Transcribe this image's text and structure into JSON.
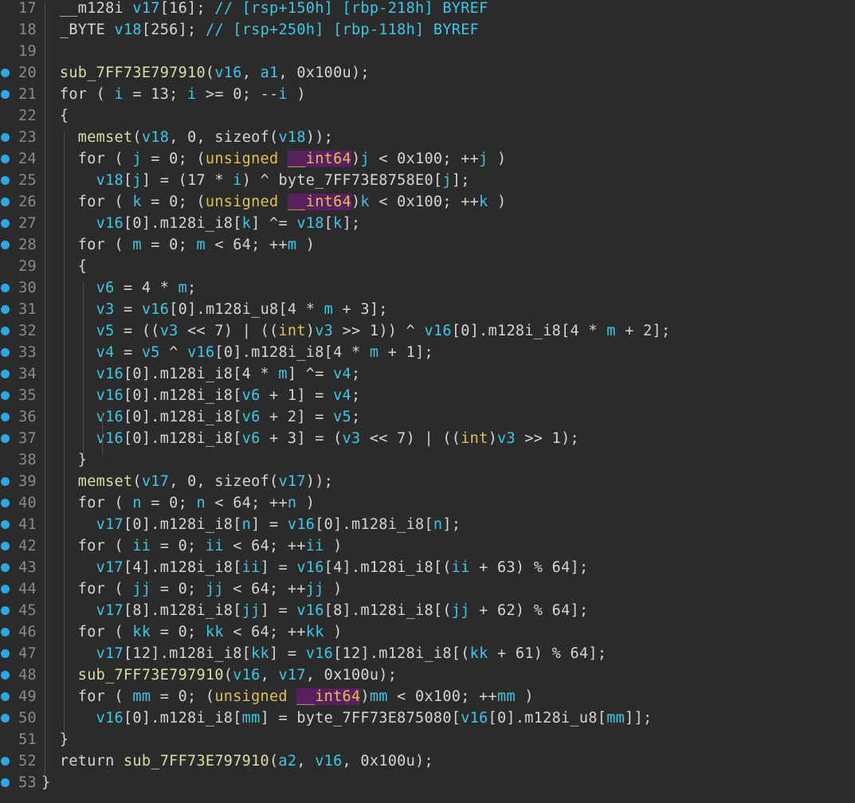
{
  "colors": {
    "background": "#2b2b2b",
    "line_number": "#8a8a8a",
    "breakpoint": "#29a8e8",
    "variable": "#3ac8e8",
    "type": "#e0c14f",
    "highlight": "#5a1f5e",
    "text": "#d4d4d4"
  },
  "lines": [
    {
      "num": "17",
      "bp": false,
      "tokens": [
        [
          "plain",
          "  "
        ],
        [
          "plain",
          "__m128i "
        ],
        [
          "var",
          "v17"
        ],
        [
          "plain",
          "[16]; "
        ],
        [
          "cmt",
          "// [rsp+150h] [rbp-218h] BYREF"
        ]
      ]
    },
    {
      "num": "18",
      "bp": false,
      "tokens": [
        [
          "plain",
          "  "
        ],
        [
          "plain",
          "_BYTE "
        ],
        [
          "var",
          "v18"
        ],
        [
          "plain",
          "[256]; "
        ],
        [
          "cmt",
          "// [rsp+250h] [rbp-118h] BYREF"
        ]
      ]
    },
    {
      "num": "19",
      "bp": false,
      "tokens": []
    },
    {
      "num": "20",
      "bp": true,
      "tokens": [
        [
          "plain",
          "  "
        ],
        [
          "func",
          "sub_7FF73E797910"
        ],
        [
          "plain",
          "("
        ],
        [
          "var",
          "v16"
        ],
        [
          "plain",
          ", "
        ],
        [
          "var",
          "a1"
        ],
        [
          "plain",
          ", 0x100u);"
        ]
      ]
    },
    {
      "num": "21",
      "bp": true,
      "tokens": [
        [
          "plain",
          "  for ( "
        ],
        [
          "var",
          "i"
        ],
        [
          "plain",
          " = 13; "
        ],
        [
          "var",
          "i"
        ],
        [
          "plain",
          " >= 0; --"
        ],
        [
          "var",
          "i"
        ],
        [
          "plain",
          " )"
        ]
      ]
    },
    {
      "num": "22",
      "bp": false,
      "tokens": [
        [
          "plain",
          "  {"
        ]
      ]
    },
    {
      "num": "23",
      "bp": true,
      "tokens": [
        [
          "plain",
          "    "
        ],
        [
          "func",
          "memset"
        ],
        [
          "plain",
          "("
        ],
        [
          "var",
          "v18"
        ],
        [
          "plain",
          ", 0, sizeof("
        ],
        [
          "var",
          "v18"
        ],
        [
          "plain",
          "));"
        ]
      ]
    },
    {
      "num": "24",
      "bp": true,
      "tokens": [
        [
          "plain",
          "    for ( "
        ],
        [
          "var",
          "j"
        ],
        [
          "plain",
          " = 0; ("
        ],
        [
          "type",
          "unsigned "
        ],
        [
          "typehl",
          "__int64"
        ],
        [
          "plain",
          ")"
        ],
        [
          "var",
          "j"
        ],
        [
          "plain",
          " < 0x100; ++"
        ],
        [
          "var",
          "j"
        ],
        [
          "plain",
          " )"
        ]
      ]
    },
    {
      "num": "25",
      "bp": true,
      "tokens": [
        [
          "plain",
          "      "
        ],
        [
          "var",
          "v18"
        ],
        [
          "plain",
          "["
        ],
        [
          "var",
          "j"
        ],
        [
          "plain",
          "] = (17 * "
        ],
        [
          "var",
          "i"
        ],
        [
          "plain",
          ") ^ byte_7FF73E8758E0["
        ],
        [
          "var",
          "j"
        ],
        [
          "plain",
          "];"
        ]
      ]
    },
    {
      "num": "26",
      "bp": true,
      "tokens": [
        [
          "plain",
          "    for ( "
        ],
        [
          "var",
          "k"
        ],
        [
          "plain",
          " = 0; ("
        ],
        [
          "type",
          "unsigned "
        ],
        [
          "typehl",
          "__int64"
        ],
        [
          "plain",
          ")"
        ],
        [
          "var",
          "k"
        ],
        [
          "plain",
          " < 0x100; ++"
        ],
        [
          "var",
          "k"
        ],
        [
          "plain",
          " )"
        ]
      ]
    },
    {
      "num": "27",
      "bp": true,
      "tokens": [
        [
          "plain",
          "      "
        ],
        [
          "var",
          "v16"
        ],
        [
          "plain",
          "[0].m128i_i8["
        ],
        [
          "var",
          "k"
        ],
        [
          "plain",
          "] ^= "
        ],
        [
          "var",
          "v18"
        ],
        [
          "plain",
          "["
        ],
        [
          "var",
          "k"
        ],
        [
          "plain",
          "];"
        ]
      ]
    },
    {
      "num": "28",
      "bp": true,
      "tokens": [
        [
          "plain",
          "    for ( "
        ],
        [
          "var",
          "m"
        ],
        [
          "plain",
          " = 0; "
        ],
        [
          "var",
          "m"
        ],
        [
          "plain",
          " < 64; ++"
        ],
        [
          "var",
          "m"
        ],
        [
          "plain",
          " )"
        ]
      ]
    },
    {
      "num": "29",
      "bp": false,
      "tokens": [
        [
          "plain",
          "    {"
        ]
      ]
    },
    {
      "num": "30",
      "bp": true,
      "tokens": [
        [
          "plain",
          "      "
        ],
        [
          "var",
          "v6"
        ],
        [
          "plain",
          " = 4 * "
        ],
        [
          "var",
          "m"
        ],
        [
          "plain",
          ";"
        ]
      ]
    },
    {
      "num": "31",
      "bp": true,
      "tokens": [
        [
          "plain",
          "      "
        ],
        [
          "var",
          "v3"
        ],
        [
          "plain",
          " = "
        ],
        [
          "var",
          "v16"
        ],
        [
          "plain",
          "[0].m128i_u8[4 * "
        ],
        [
          "var",
          "m"
        ],
        [
          "plain",
          " + 3];"
        ]
      ]
    },
    {
      "num": "32",
      "bp": true,
      "tokens": [
        [
          "plain",
          "      "
        ],
        [
          "var",
          "v5"
        ],
        [
          "plain",
          " = (("
        ],
        [
          "var",
          "v3"
        ],
        [
          "plain",
          " << 7) | (("
        ],
        [
          "type",
          "int"
        ],
        [
          "plain",
          ")"
        ],
        [
          "var",
          "v3"
        ],
        [
          "plain",
          " >> 1)) ^ "
        ],
        [
          "var",
          "v16"
        ],
        [
          "plain",
          "[0].m128i_i8[4 * "
        ],
        [
          "var",
          "m"
        ],
        [
          "plain",
          " + 2];"
        ]
      ]
    },
    {
      "num": "33",
      "bp": true,
      "tokens": [
        [
          "plain",
          "      "
        ],
        [
          "var",
          "v4"
        ],
        [
          "plain",
          " = "
        ],
        [
          "var",
          "v5"
        ],
        [
          "plain",
          " ^ "
        ],
        [
          "var",
          "v16"
        ],
        [
          "plain",
          "[0].m128i_i8[4 * "
        ],
        [
          "var",
          "m"
        ],
        [
          "plain",
          " + 1];"
        ]
      ]
    },
    {
      "num": "34",
      "bp": true,
      "tokens": [
        [
          "plain",
          "      "
        ],
        [
          "var",
          "v16"
        ],
        [
          "plain",
          "[0].m128i_i8[4 * "
        ],
        [
          "var",
          "m"
        ],
        [
          "plain",
          "] ^= "
        ],
        [
          "var",
          "v4"
        ],
        [
          "plain",
          ";"
        ]
      ]
    },
    {
      "num": "35",
      "bp": true,
      "tokens": [
        [
          "plain",
          "      "
        ],
        [
          "var",
          "v16"
        ],
        [
          "plain",
          "[0].m128i_i8["
        ],
        [
          "var",
          "v6"
        ],
        [
          "plain",
          " + 1] = "
        ],
        [
          "var",
          "v4"
        ],
        [
          "plain",
          ";"
        ]
      ]
    },
    {
      "num": "36",
      "bp": true,
      "tokens": [
        [
          "plain",
          "      "
        ],
        [
          "var",
          "v16"
        ],
        [
          "plain",
          "[0].m128i_i8["
        ],
        [
          "var",
          "v6"
        ],
        [
          "plain",
          " + 2] = "
        ],
        [
          "var",
          "v5"
        ],
        [
          "plain",
          ";"
        ]
      ]
    },
    {
      "num": "37",
      "bp": true,
      "tokens": [
        [
          "plain",
          "      "
        ],
        [
          "var",
          "v16"
        ],
        [
          "plain",
          "[0].m128i_i8["
        ],
        [
          "var",
          "v6"
        ],
        [
          "plain",
          " + 3] = ("
        ],
        [
          "var",
          "v3"
        ],
        [
          "plain",
          " << 7) | (("
        ],
        [
          "type",
          "int"
        ],
        [
          "plain",
          ")"
        ],
        [
          "var",
          "v3"
        ],
        [
          "plain",
          " >> 1);"
        ]
      ]
    },
    {
      "num": "38",
      "bp": false,
      "tokens": [
        [
          "plain",
          "    }"
        ]
      ]
    },
    {
      "num": "39",
      "bp": true,
      "tokens": [
        [
          "plain",
          "    "
        ],
        [
          "func",
          "memset"
        ],
        [
          "plain",
          "("
        ],
        [
          "var",
          "v17"
        ],
        [
          "plain",
          ", 0, sizeof("
        ],
        [
          "var",
          "v17"
        ],
        [
          "plain",
          "));"
        ]
      ]
    },
    {
      "num": "40",
      "bp": true,
      "tokens": [
        [
          "plain",
          "    for ( "
        ],
        [
          "var",
          "n"
        ],
        [
          "plain",
          " = 0; "
        ],
        [
          "var",
          "n"
        ],
        [
          "plain",
          " < 64; ++"
        ],
        [
          "var",
          "n"
        ],
        [
          "plain",
          " )"
        ]
      ]
    },
    {
      "num": "41",
      "bp": true,
      "tokens": [
        [
          "plain",
          "      "
        ],
        [
          "var",
          "v17"
        ],
        [
          "plain",
          "[0].m128i_i8["
        ],
        [
          "var",
          "n"
        ],
        [
          "plain",
          "] = "
        ],
        [
          "var",
          "v16"
        ],
        [
          "plain",
          "[0].m128i_i8["
        ],
        [
          "var",
          "n"
        ],
        [
          "plain",
          "];"
        ]
      ]
    },
    {
      "num": "42",
      "bp": true,
      "tokens": [
        [
          "plain",
          "    for ( "
        ],
        [
          "var",
          "ii"
        ],
        [
          "plain",
          " = 0; "
        ],
        [
          "var",
          "ii"
        ],
        [
          "plain",
          " < 64; ++"
        ],
        [
          "var",
          "ii"
        ],
        [
          "plain",
          " )"
        ]
      ]
    },
    {
      "num": "43",
      "bp": true,
      "tokens": [
        [
          "plain",
          "      "
        ],
        [
          "var",
          "v17"
        ],
        [
          "plain",
          "[4].m128i_i8["
        ],
        [
          "var",
          "ii"
        ],
        [
          "plain",
          "] = "
        ],
        [
          "var",
          "v16"
        ],
        [
          "plain",
          "[4].m128i_i8[("
        ],
        [
          "var",
          "ii"
        ],
        [
          "plain",
          " + 63) % 64];"
        ]
      ]
    },
    {
      "num": "44",
      "bp": true,
      "tokens": [
        [
          "plain",
          "    for ( "
        ],
        [
          "var",
          "jj"
        ],
        [
          "plain",
          " = 0; "
        ],
        [
          "var",
          "jj"
        ],
        [
          "plain",
          " < 64; ++"
        ],
        [
          "var",
          "jj"
        ],
        [
          "plain",
          " )"
        ]
      ]
    },
    {
      "num": "45",
      "bp": true,
      "tokens": [
        [
          "plain",
          "      "
        ],
        [
          "var",
          "v17"
        ],
        [
          "plain",
          "[8].m128i_i8["
        ],
        [
          "var",
          "jj"
        ],
        [
          "plain",
          "] = "
        ],
        [
          "var",
          "v16"
        ],
        [
          "plain",
          "[8].m128i_i8[("
        ],
        [
          "var",
          "jj"
        ],
        [
          "plain",
          " + 62) % 64];"
        ]
      ]
    },
    {
      "num": "46",
      "bp": true,
      "tokens": [
        [
          "plain",
          "    for ( "
        ],
        [
          "var",
          "kk"
        ],
        [
          "plain",
          " = 0; "
        ],
        [
          "var",
          "kk"
        ],
        [
          "plain",
          " < 64; ++"
        ],
        [
          "var",
          "kk"
        ],
        [
          "plain",
          " )"
        ]
      ]
    },
    {
      "num": "47",
      "bp": true,
      "tokens": [
        [
          "plain",
          "      "
        ],
        [
          "var",
          "v17"
        ],
        [
          "plain",
          "[12].m128i_i8["
        ],
        [
          "var",
          "kk"
        ],
        [
          "plain",
          "] = "
        ],
        [
          "var",
          "v16"
        ],
        [
          "plain",
          "[12].m128i_i8[("
        ],
        [
          "var",
          "kk"
        ],
        [
          "plain",
          " + 61) % 64];"
        ]
      ]
    },
    {
      "num": "48",
      "bp": true,
      "tokens": [
        [
          "plain",
          "    "
        ],
        [
          "func",
          "sub_7FF73E797910"
        ],
        [
          "plain",
          "("
        ],
        [
          "var",
          "v16"
        ],
        [
          "plain",
          ", "
        ],
        [
          "var",
          "v17"
        ],
        [
          "plain",
          ", 0x100u);"
        ]
      ]
    },
    {
      "num": "49",
      "bp": true,
      "tokens": [
        [
          "plain",
          "    for ( "
        ],
        [
          "var",
          "mm"
        ],
        [
          "plain",
          " = 0; ("
        ],
        [
          "type",
          "unsigned "
        ],
        [
          "typehl",
          "__int64"
        ],
        [
          "plain",
          ")"
        ],
        [
          "var",
          "mm"
        ],
        [
          "plain",
          " < 0x100; ++"
        ],
        [
          "var",
          "mm"
        ],
        [
          "plain",
          " )"
        ]
      ]
    },
    {
      "num": "50",
      "bp": true,
      "tokens": [
        [
          "plain",
          "      "
        ],
        [
          "var",
          "v16"
        ],
        [
          "plain",
          "[0].m128i_i8["
        ],
        [
          "var",
          "mm"
        ],
        [
          "plain",
          "] = byte_7FF73E875080["
        ],
        [
          "var",
          "v16"
        ],
        [
          "plain",
          "[0].m128i_u8["
        ],
        [
          "var",
          "mm"
        ],
        [
          "plain",
          "]];"
        ]
      ]
    },
    {
      "num": "51",
      "bp": false,
      "tokens": [
        [
          "plain",
          "  }"
        ]
      ]
    },
    {
      "num": "52",
      "bp": true,
      "tokens": [
        [
          "plain",
          "  return "
        ],
        [
          "func",
          "sub_7FF73E797910"
        ],
        [
          "plain",
          "("
        ],
        [
          "var",
          "a2"
        ],
        [
          "plain",
          ", "
        ],
        [
          "var",
          "v16"
        ],
        [
          "plain",
          ", 0x100u);"
        ]
      ]
    },
    {
      "num": "53",
      "bp": true,
      "tokens": [
        [
          "plain",
          "}"
        ]
      ]
    }
  ]
}
